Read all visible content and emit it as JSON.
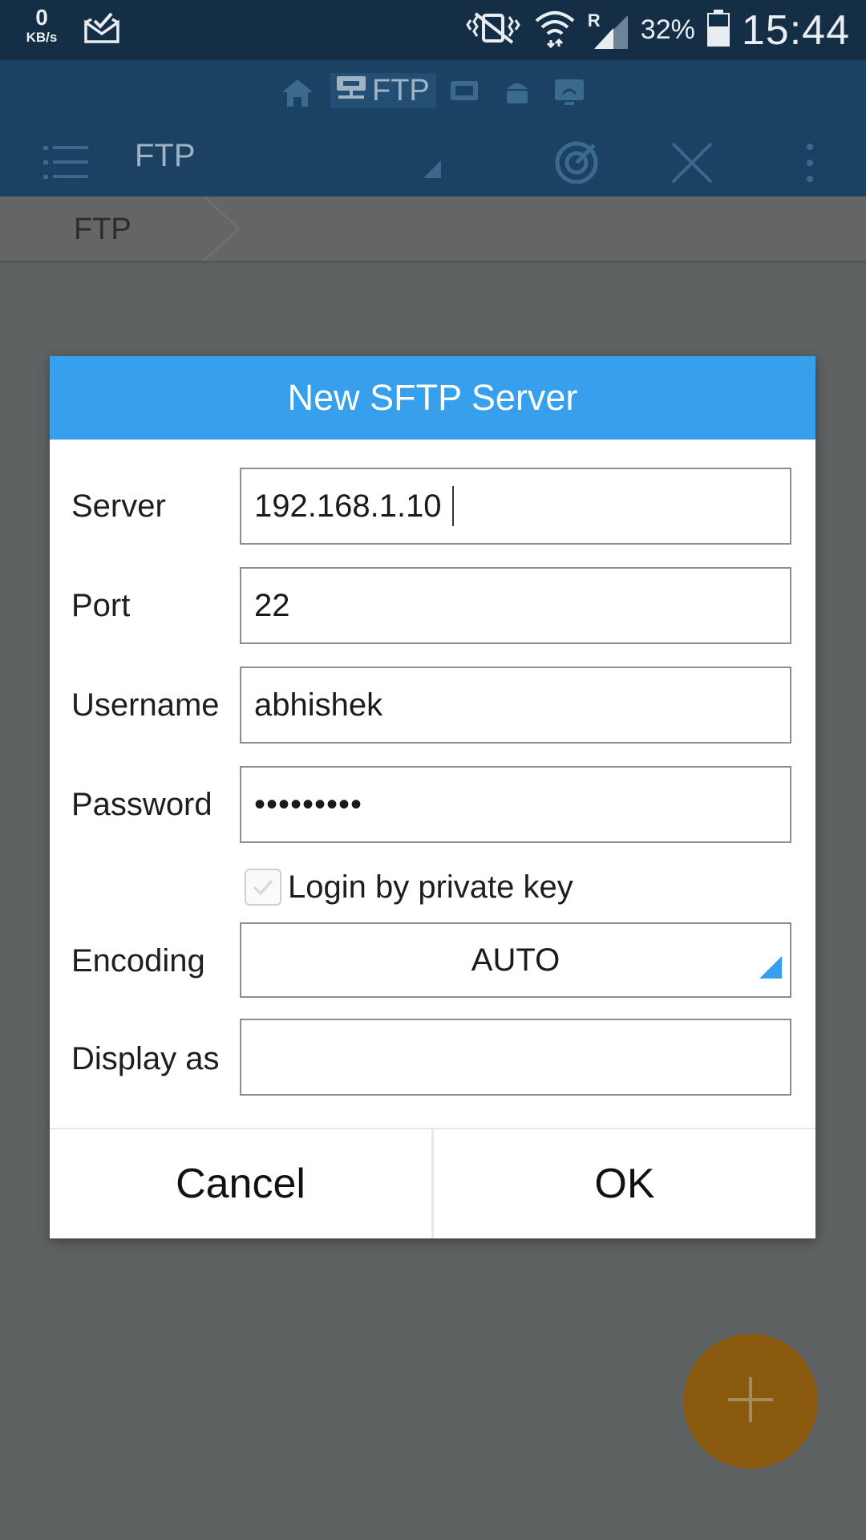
{
  "status_bar": {
    "speed_value": "0",
    "speed_unit": "KB/s",
    "roaming_indicator": "R",
    "battery_percent": "32%",
    "time": "15:44"
  },
  "app_bar": {
    "active_tab_label": "FTP",
    "title": "FTP",
    "icons": [
      "home-icon",
      "ftp-network-icon",
      "media-icon",
      "android-icon",
      "remote-icon",
      "menu-icon",
      "radar-icon",
      "close-icon",
      "overflow-menu-icon"
    ]
  },
  "breadcrumb": {
    "current": "FTP"
  },
  "dialog": {
    "title": "New SFTP Server",
    "fields": {
      "server": {
        "label": "Server",
        "value": "192.168.1.10"
      },
      "port": {
        "label": "Port",
        "value": "22"
      },
      "username": {
        "label": "Username",
        "value": "abhishek"
      },
      "password": {
        "label": "Password",
        "value": "•••••••••"
      },
      "login_by_private_key": {
        "label": "Login by private key",
        "checked": false
      },
      "encoding": {
        "label": "Encoding",
        "value": "AUTO"
      },
      "display_as": {
        "label": "Display as",
        "value": ""
      }
    },
    "cancel_label": "Cancel",
    "ok_label": "OK"
  },
  "colors": {
    "status_bar_bg": "#142f45",
    "app_bar_bg": "#1b4263",
    "dialog_header_bg": "#36a0ec",
    "accent": "#36a0ec",
    "fab_bg": "#8a5b0f",
    "scrim_bg": "#5f6263"
  }
}
